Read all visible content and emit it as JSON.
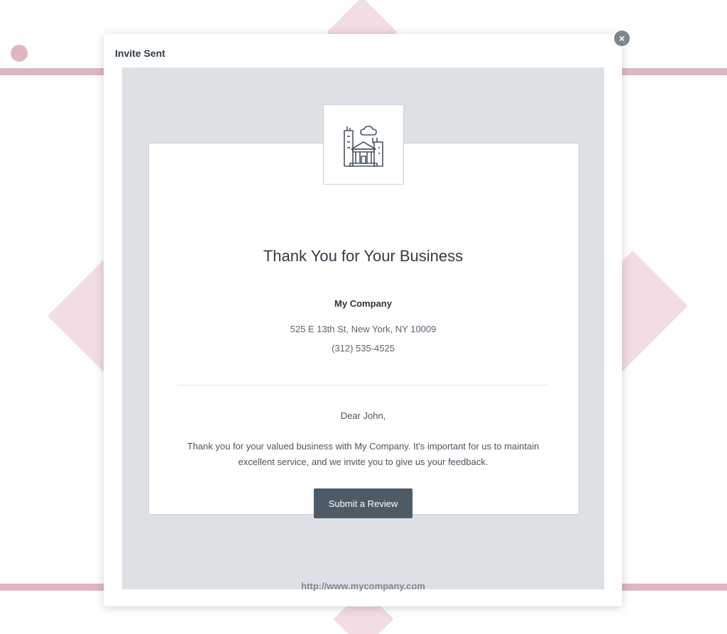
{
  "modal": {
    "title": "Invite Sent",
    "close_icon": "close-icon",
    "close_glyph": "×"
  },
  "email": {
    "logo_icon": "building-icon",
    "heading": "Thank You for Your Business",
    "company_name": "My Company",
    "address": "525 E 13th St, New York, NY 10009",
    "phone": "(312) 535-4525",
    "greeting": "Dear John,",
    "body": "Thank you for your valued business with My Company. It's important for us to maintain excellent service, and we invite you to give us your feedback.",
    "button_label": "Submit a Review",
    "footer_link": "http://www.mycompany.com"
  },
  "colors": {
    "background_accent": "#e2b6c0",
    "email_background": "#dde1e5",
    "button": "#4d5b67"
  }
}
